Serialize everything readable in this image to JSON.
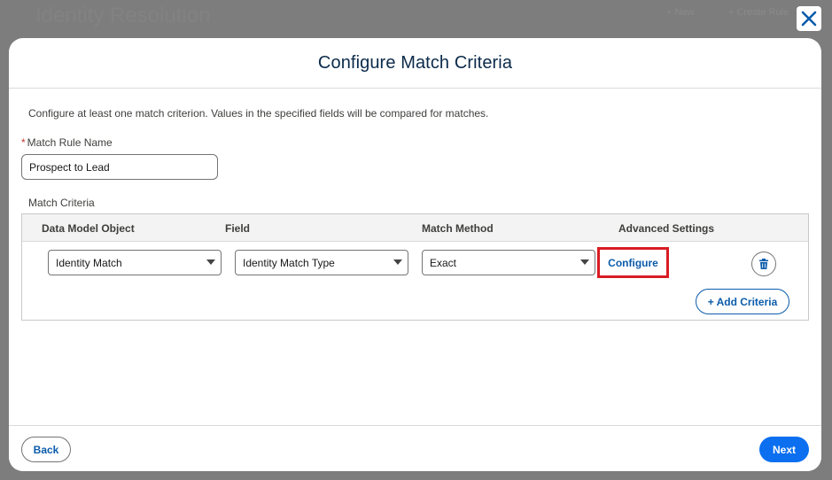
{
  "background": {
    "page_title": "Identity Resolution",
    "buttons": [
      "+ New",
      "+ Create Rule"
    ]
  },
  "modal": {
    "title": "Configure Match Criteria",
    "description": "Configure at least one match criterion. Values in the specified fields will be compared for matches.",
    "match_rule_name": {
      "label": "Match Rule Name",
      "required_marker": "*",
      "value": "Prospect to Lead"
    },
    "criteria": {
      "section_label": "Match Criteria",
      "columns": [
        "Data Model Object",
        "Field",
        "Match Method",
        "Advanced Settings"
      ],
      "rows": [
        {
          "data_model_object": "Identity Match",
          "field": "Identity Match Type",
          "match_method": "Exact",
          "advanced_settings_link": "Configure"
        }
      ],
      "add_button": "+ Add Criteria"
    },
    "footer": {
      "back_label": "Back",
      "next_label": "Next"
    }
  },
  "icons": {
    "close": "close-icon",
    "delete": "trash-icon",
    "dropdown": "chevron-down-icon"
  },
  "colors": {
    "brand_blue": "#0b5cab",
    "primary_button": "#0b6ff0",
    "highlight_red": "#d81c24",
    "required_red": "#c23934"
  }
}
